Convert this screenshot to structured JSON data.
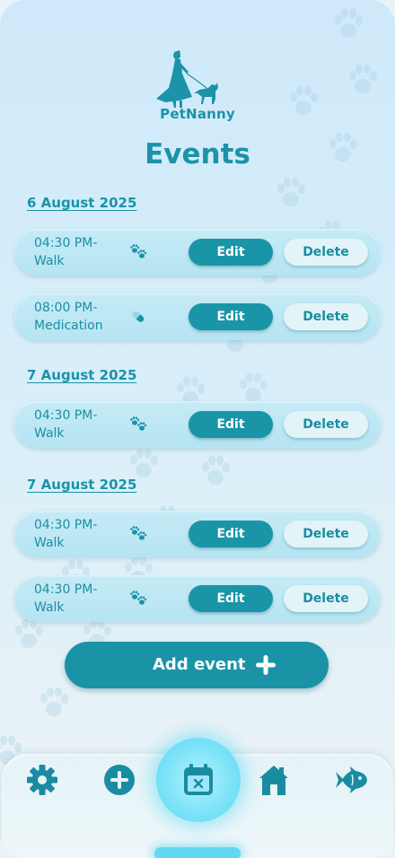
{
  "app": {
    "logo_text": "PetNanny"
  },
  "header": {
    "title": "Events"
  },
  "groups": [
    {
      "date": "6 August 2025",
      "events": [
        {
          "time": "04:30 PM-",
          "type": "Walk",
          "icon": "paw-icon",
          "edit_label": "Edit",
          "delete_label": "Delete"
        },
        {
          "time": "08:00 PM-",
          "type": "Medication",
          "icon": "pill-icon",
          "edit_label": "Edit",
          "delete_label": "Delete"
        }
      ]
    },
    {
      "date": "7 August 2025",
      "events": [
        {
          "time": "04:30 PM-",
          "type": "Walk",
          "icon": "paw-icon",
          "edit_label": "Edit",
          "delete_label": "Delete"
        }
      ]
    },
    {
      "date": "7 August 2025",
      "events": [
        {
          "time": "04:30 PM-",
          "type": "Walk",
          "icon": "paw-icon",
          "edit_label": "Edit",
          "delete_label": "Delete"
        },
        {
          "time": "04:30 PM-",
          "type": "Walk",
          "icon": "paw-icon",
          "edit_label": "Edit",
          "delete_label": "Delete"
        }
      ]
    }
  ],
  "add_event": {
    "label": "Add event",
    "icon": "plus-icon"
  },
  "nav": [
    {
      "name": "settings",
      "icon": "gear-icon"
    },
    {
      "name": "add",
      "icon": "plus-circle-icon"
    },
    {
      "name": "calendar",
      "icon": "calendar-x-icon",
      "active": true
    },
    {
      "name": "home",
      "icon": "home-icon"
    },
    {
      "name": "fish",
      "icon": "fish-icon"
    }
  ],
  "colors": {
    "accent": "#1a93a7",
    "card": "#bfe8f4",
    "delete_bg": "#e2f4f8",
    "active_glow": "#7ee3f8"
  }
}
